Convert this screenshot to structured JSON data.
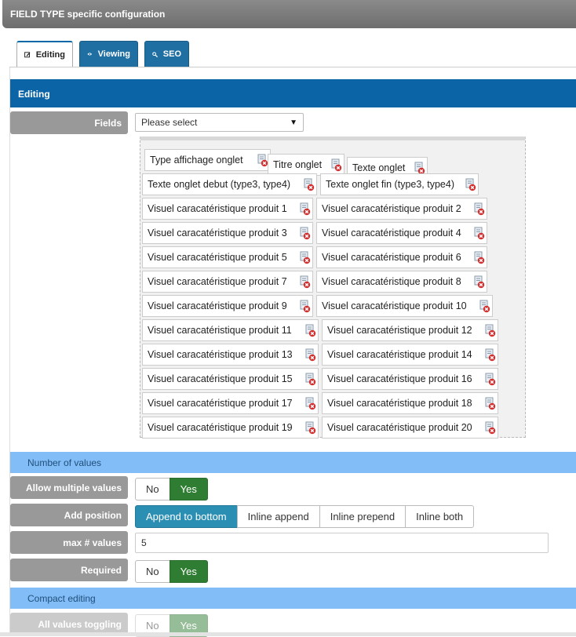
{
  "header": {
    "title": "FIELD TYPE specific configuration"
  },
  "tabs": [
    {
      "label": "Editing",
      "icon": "edit-icon",
      "active": true
    },
    {
      "label": "Viewing",
      "icon": "eye-icon",
      "active": false
    },
    {
      "label": "SEO",
      "icon": "search-icon",
      "active": false
    }
  ],
  "sections": {
    "editing": "Editing",
    "number_of_values": "Number of values",
    "compact_editing": "Compact editing"
  },
  "fields": {
    "label": "Fields",
    "select_placeholder": "Please select",
    "tags": [
      "Type affichage onglet",
      "Titre onglet",
      "Texte onglet",
      "Texte onglet debut (type3, type4)",
      "Texte onglet fin (type3, type4)",
      "Visuel caracatéristique produit 1",
      "Visuel caracatéristique produit 2",
      "Visuel caracatéristique produit 3",
      "Visuel caracatéristique produit 4",
      "Visuel caracatéristique produit 5",
      "Visuel caracatéristique produit 6",
      "Visuel caracatéristique produit 7",
      "Visuel caracatéristique produit 8",
      "Visuel caracatéristique produit 9",
      "Visuel caracatéristique produit 10",
      "Visuel caracatéristique produit 11",
      "Visuel caracatéristique produit 12",
      "Visuel caracatéristique produit 13",
      "Visuel caracatéristique produit 14",
      "Visuel caracatéristique produit 15",
      "Visuel caracatéristique produit 16",
      "Visuel caracatéristique produit 17",
      "Visuel caracatéristique produit 18",
      "Visuel caracatéristique produit 19",
      "Visuel caracatéristique produit 20"
    ]
  },
  "allow_multiple": {
    "label": "Allow multiple values",
    "no": "No",
    "yes": "Yes",
    "selected": "yes"
  },
  "add_position": {
    "label": "Add position",
    "options": [
      "Append to bottom",
      "Inline append",
      "Inline prepend",
      "Inline both"
    ],
    "selected": 0
  },
  "max_values": {
    "label": "max # values",
    "value": "5"
  },
  "required": {
    "label": "Required",
    "no": "No",
    "yes": "Yes",
    "selected": "yes"
  },
  "all_values_toggling": {
    "label": "All values toggling",
    "no": "No",
    "yes": "Yes",
    "selected": "yes"
  },
  "colors": {
    "tab_blue": "#1f6fa3",
    "section_dark": "#0b64a6",
    "section_light": "#82bdf7",
    "label_gray": "#999999",
    "yes_green": "#2e7d32",
    "selected_teal": "#2b8fb4"
  }
}
